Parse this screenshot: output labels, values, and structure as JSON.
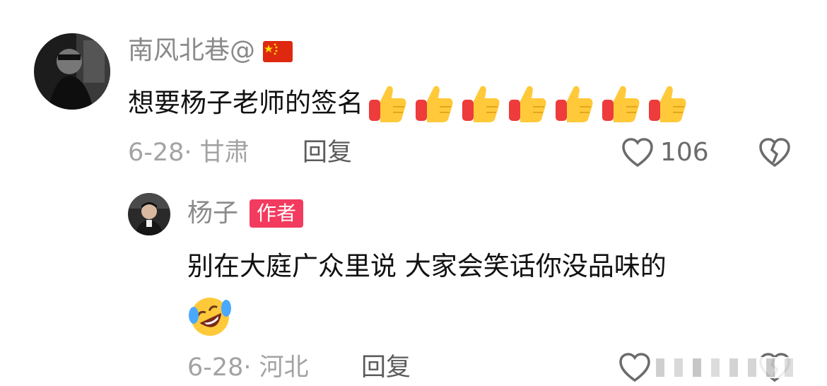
{
  "comments": [
    {
      "username": "南风北巷@",
      "flag_icon": "china-flag-icon",
      "text": "想要杨子老师的签名",
      "emoji_icons": [
        "thumbs-up-icon",
        "thumbs-up-icon",
        "thumbs-up-icon",
        "thumbs-up-icon",
        "thumbs-up-icon",
        "thumbs-up-icon",
        "thumbs-up-icon"
      ],
      "date_location": "6-28· 甘肃",
      "reply_label": "回复",
      "like_count": "106"
    }
  ],
  "reply": {
    "username": "杨子",
    "badge": "作者",
    "text": "别在大庭广众里说 大家会笑话你没品味的",
    "emoji_icon": "rolling-laughing-icon",
    "date_location": "6-28· 河北",
    "reply_label": "回复"
  },
  "colors": {
    "badge": "#f23b5f",
    "name": "#8a8a8a",
    "meta": "#a3a3a3"
  }
}
